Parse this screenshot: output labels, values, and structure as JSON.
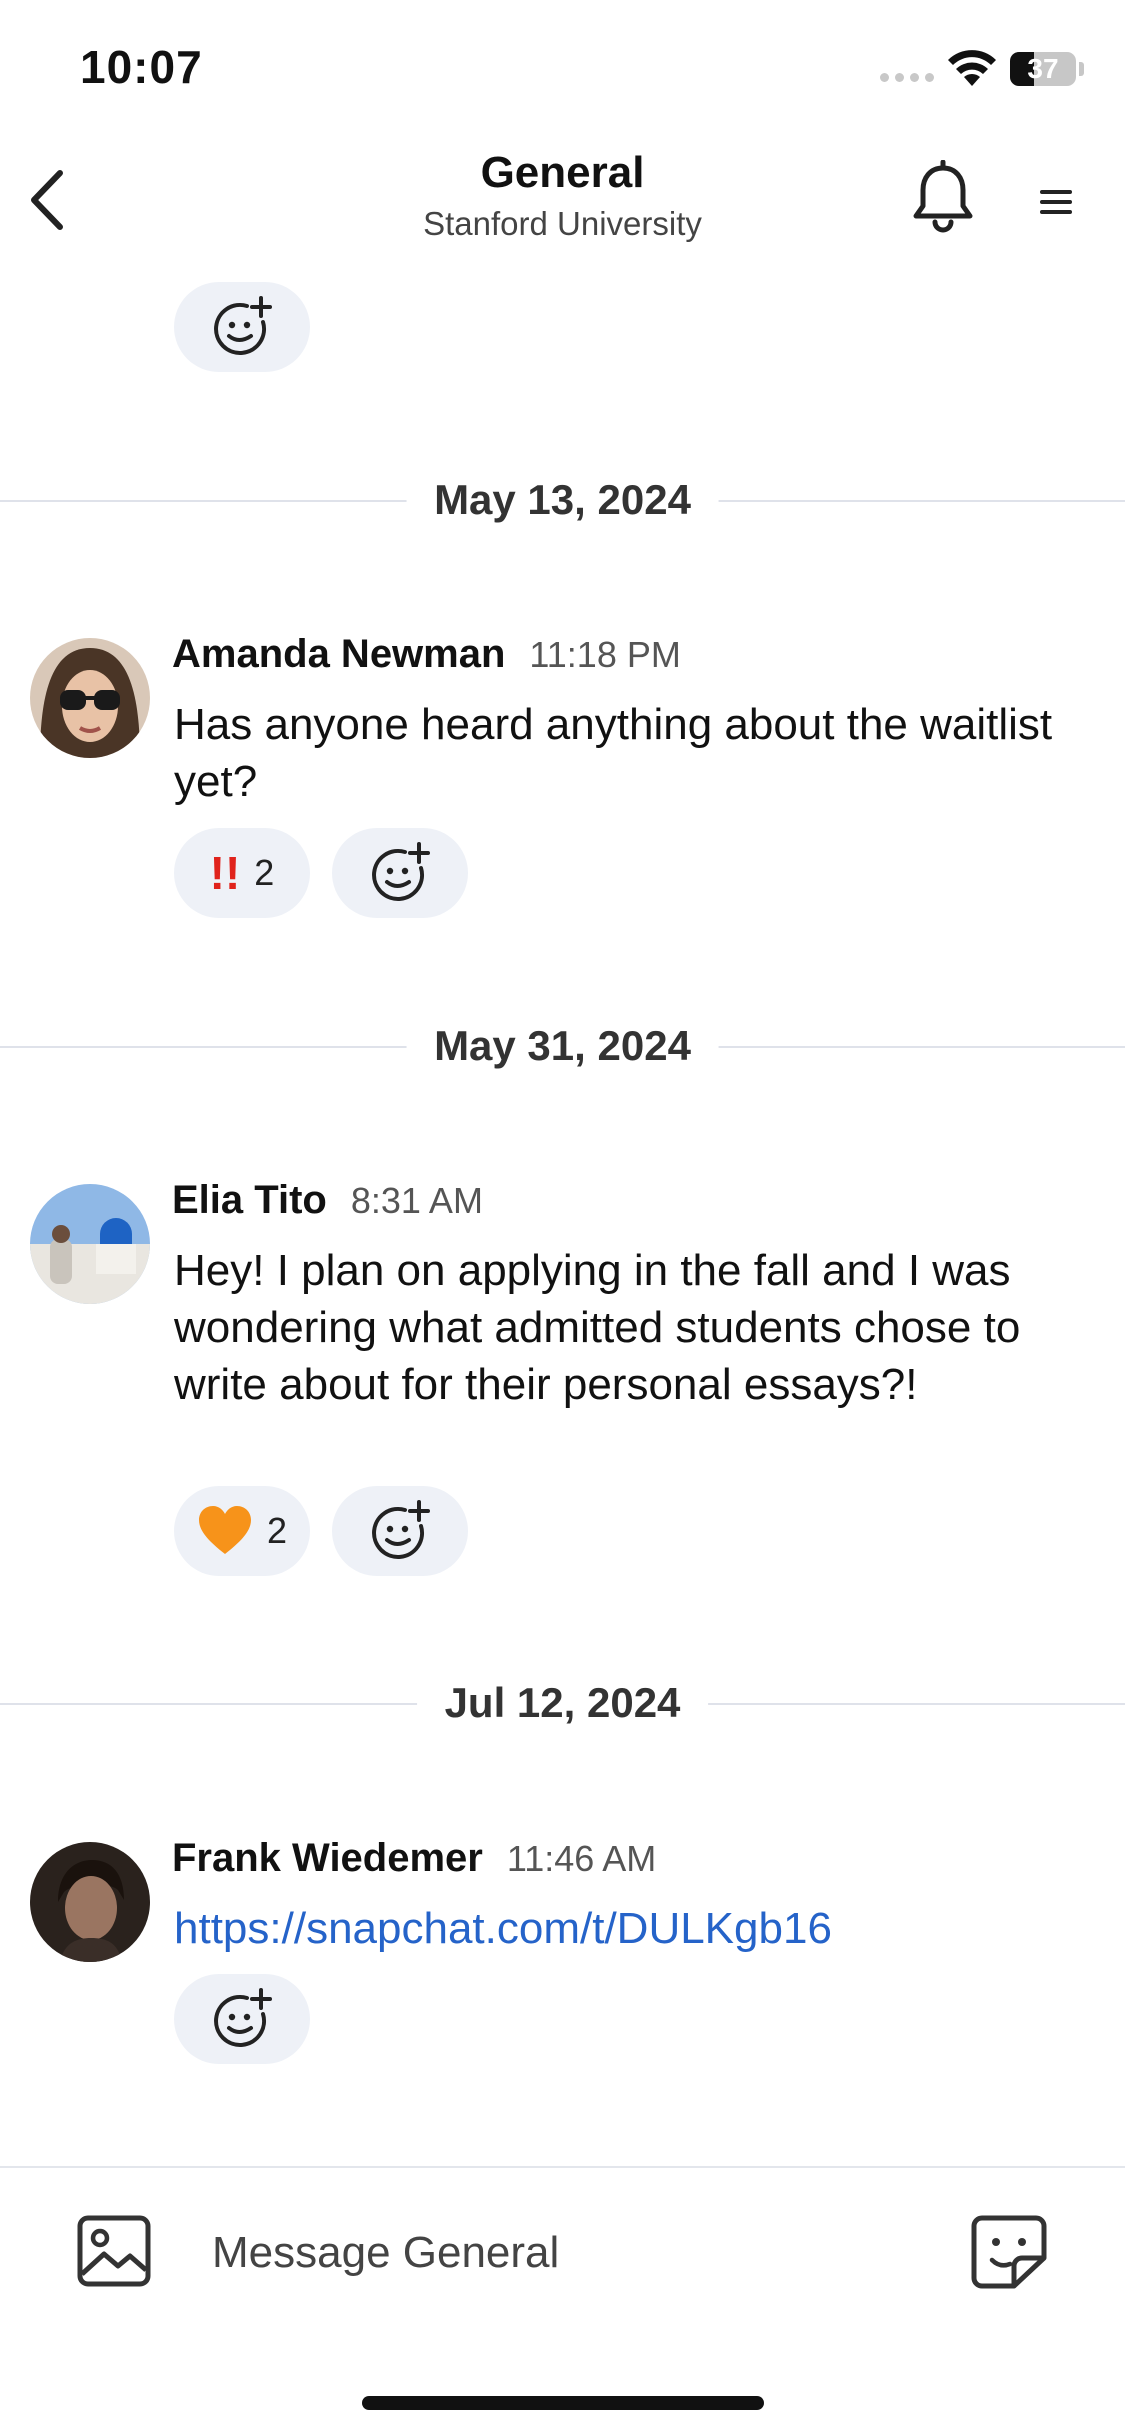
{
  "status_bar": {
    "time": "10:07",
    "battery_level": "37",
    "battery_fraction": 0.37
  },
  "header": {
    "title": "General",
    "subtitle": "Stanford University"
  },
  "feed": {
    "dividers": [
      "May 13, 2024",
      "May 31, 2024",
      "Jul 12, 2024"
    ],
    "messages": [
      {
        "author": "Amanda Newman",
        "time": "11:18 PM",
        "text": "Has anyone heard anything about the waitlist yet?",
        "reaction": {
          "emoji": "‼️",
          "count": "2"
        }
      },
      {
        "author": "Elia Tito",
        "time": "8:31 AM",
        "text": "Hey! I plan on applying in the fall and I was wondering what admitted students chose to write about for their personal essays?!",
        "reaction": {
          "emoji": "🧡",
          "count": "2"
        }
      },
      {
        "author": "Frank Wiedemer",
        "time": "11:46 AM",
        "text": "https://snapchat.com/t/DULKgb16"
      }
    ]
  },
  "composer": {
    "placeholder": "Message General"
  },
  "colors": {
    "accent_link": "#2563c9",
    "pill_bg": "#eef1f7",
    "divider": "#dfe2ea",
    "heart": "#f7931a",
    "exclaim": "#e0231c"
  }
}
